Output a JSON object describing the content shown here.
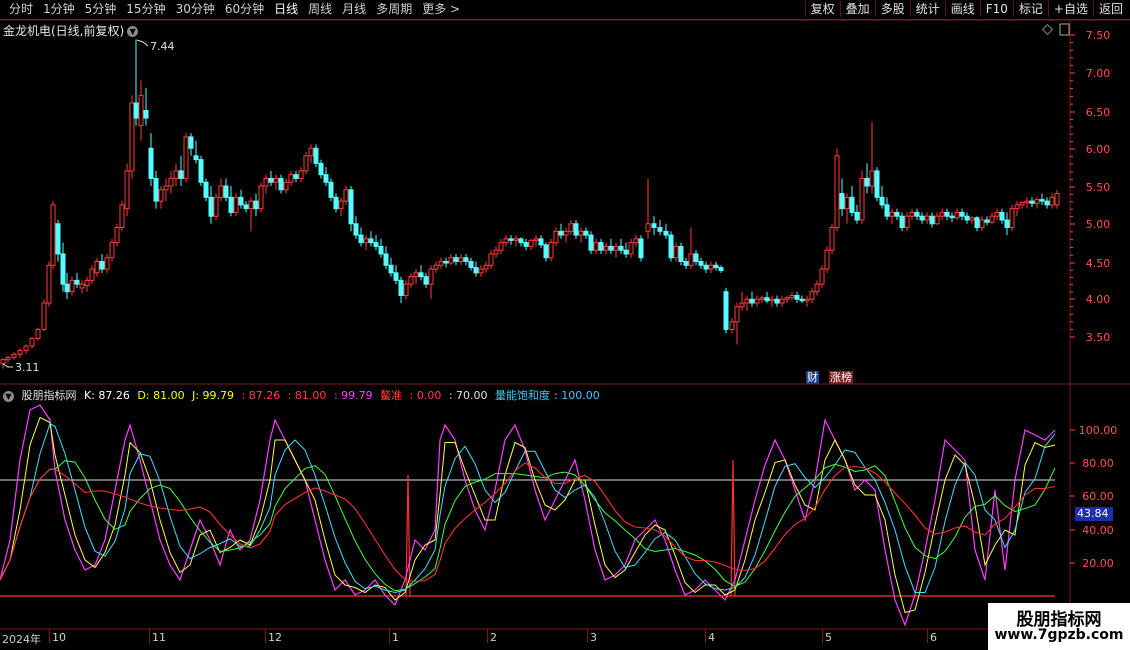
{
  "toolbar": {
    "periods": [
      "分时",
      "1分钟",
      "5分钟",
      "15分钟",
      "30分钟",
      "60分钟",
      "日线",
      "周线",
      "月线",
      "多周期",
      "更多 >"
    ],
    "active_period": "日线",
    "buttons": [
      "复权",
      "叠加",
      "多股",
      "统计",
      "画线",
      "F10",
      "标记",
      "+自选",
      "返回"
    ]
  },
  "title": "金龙机电(日线,前复权)",
  "price_axis": [
    "7.50",
    "7.00",
    "6.50",
    "6.00",
    "5.50",
    "5.00",
    "4.50",
    "4.00",
    "3.50"
  ],
  "high_label": "7.44",
  "low_label": "3.11",
  "badges": {
    "cai": "财",
    "zhangbang": "涨榜"
  },
  "indicator": {
    "name": "股朋指标网",
    "k_label": "K: 87.26",
    "d_label": "D: 81.00",
    "j_label": "J: 99.79",
    "v1": ": 87.26",
    "v2": ": 81.00",
    "v3": ": 99.79",
    "lanlang_label": "鳌准",
    "lanlang_value": ": 0.00",
    "v4": ": 70.00",
    "sat_label": "量能饱和度",
    "sat_value": ": 100.00"
  },
  "indicator_axis": [
    "100.00",
    "80.00",
    "60.00",
    "40.00",
    "20.00"
  ],
  "current_value": "43.84",
  "date_labels": [
    "2024年",
    "10",
    "11",
    "12",
    "1",
    "2",
    "3",
    "4",
    "5",
    "6"
  ],
  "watermark": {
    "line1": "股朋指标网",
    "line2": "www.7gpzb.com"
  },
  "colors": {
    "up": "#ff3b3b",
    "down": "#54ffff",
    "k": "#ffffff",
    "d": "#ffff00",
    "j": "#ff3cff",
    "grid": "#7a1a1a",
    "axis_text": "#ff5050"
  }
}
